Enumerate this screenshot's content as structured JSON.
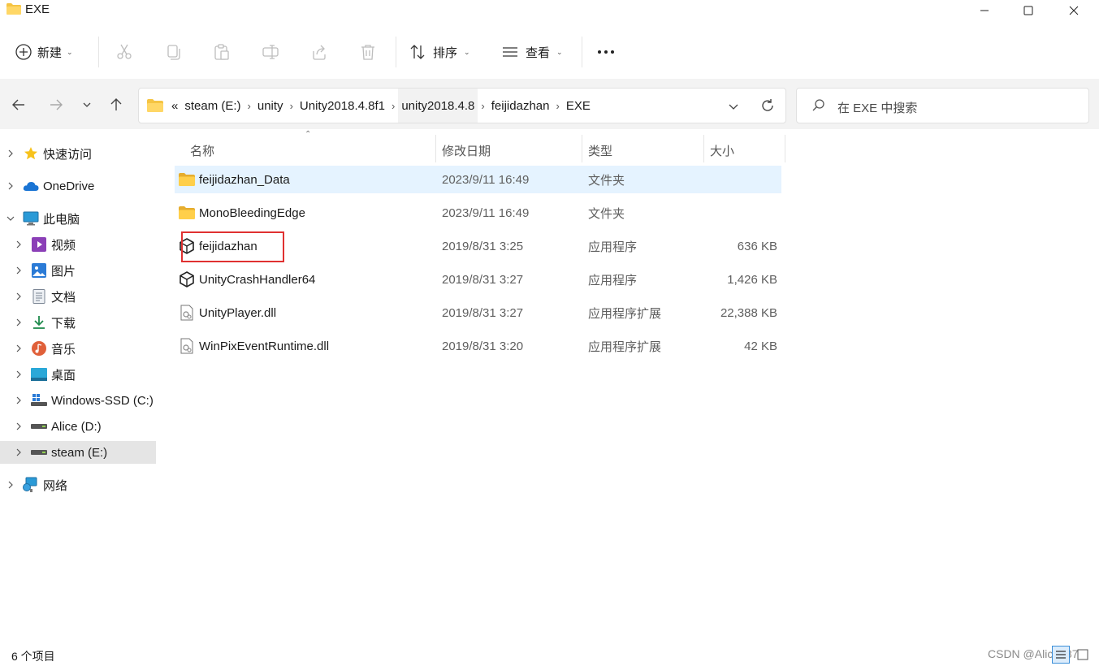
{
  "window": {
    "title": "EXE",
    "min_icon": "minimize-icon",
    "max_icon": "maximize-icon",
    "close_icon": "close-icon"
  },
  "toolbar": {
    "new_label": "新建",
    "sort_label": "排序",
    "view_label": "查看",
    "more_label": "•••"
  },
  "address": {
    "overflow": "«",
    "crumbs": [
      "steam (E:)",
      "unity",
      "Unity2018.4.8f1",
      "unity2018.4.8",
      "feijidazhan",
      "EXE"
    ],
    "highlighted_crumb": "unity2018.4.8"
  },
  "search": {
    "placeholder": "在 EXE 中搜索"
  },
  "sidebar": {
    "items": [
      {
        "label": "快速访问",
        "icon": "star-icon"
      },
      {
        "label": "OneDrive",
        "icon": "cloud-icon"
      },
      {
        "label": "此电脑",
        "icon": "monitor-icon"
      },
      {
        "label": "视频",
        "icon": "video-icon"
      },
      {
        "label": "图片",
        "icon": "picture-icon"
      },
      {
        "label": "文档",
        "icon": "document-icon"
      },
      {
        "label": "下载",
        "icon": "download-icon"
      },
      {
        "label": "音乐",
        "icon": "music-icon"
      },
      {
        "label": "桌面",
        "icon": "desktop-icon"
      },
      {
        "label": "Windows-SSD (C:)",
        "icon": "drive-icon"
      },
      {
        "label": "Alice (D:)",
        "icon": "drive-icon"
      },
      {
        "label": "steam (E:)",
        "icon": "drive-icon"
      },
      {
        "label": "网络",
        "icon": "network-icon"
      }
    ],
    "selected": "steam (E:)"
  },
  "columns": {
    "name": "名称",
    "date": "修改日期",
    "type": "类型",
    "size": "大小"
  },
  "files": [
    {
      "name": "feijidazhan_Data",
      "date": "2023/9/11 16:49",
      "type": "文件夹",
      "size": "",
      "icon": "folder-icon"
    },
    {
      "name": "MonoBleedingEdge",
      "date": "2023/9/11 16:49",
      "type": "文件夹",
      "size": "",
      "icon": "folder-icon"
    },
    {
      "name": "feijidazhan",
      "date": "2019/8/31 3:25",
      "type": "应用程序",
      "size": "636 KB",
      "icon": "unity-icon"
    },
    {
      "name": "UnityCrashHandler64",
      "date": "2019/8/31 3:27",
      "type": "应用程序",
      "size": "1,426 KB",
      "icon": "unity-icon"
    },
    {
      "name": "UnityPlayer.dll",
      "date": "2019/8/31 3:27",
      "type": "应用程序扩展",
      "size": "22,388 KB",
      "icon": "dll-icon"
    },
    {
      "name": "WinPixEventRuntime.dll",
      "date": "2019/8/31 3:20",
      "type": "应用程序扩展",
      "size": "42 KB",
      "icon": "dll-icon"
    }
  ],
  "status": {
    "count": "6 个项目",
    "watermark": "CSDN @Alice687"
  },
  "colors": {
    "folder": "#f5c443",
    "selection": "#e5f3ff",
    "highlight_box": "#e03131"
  }
}
